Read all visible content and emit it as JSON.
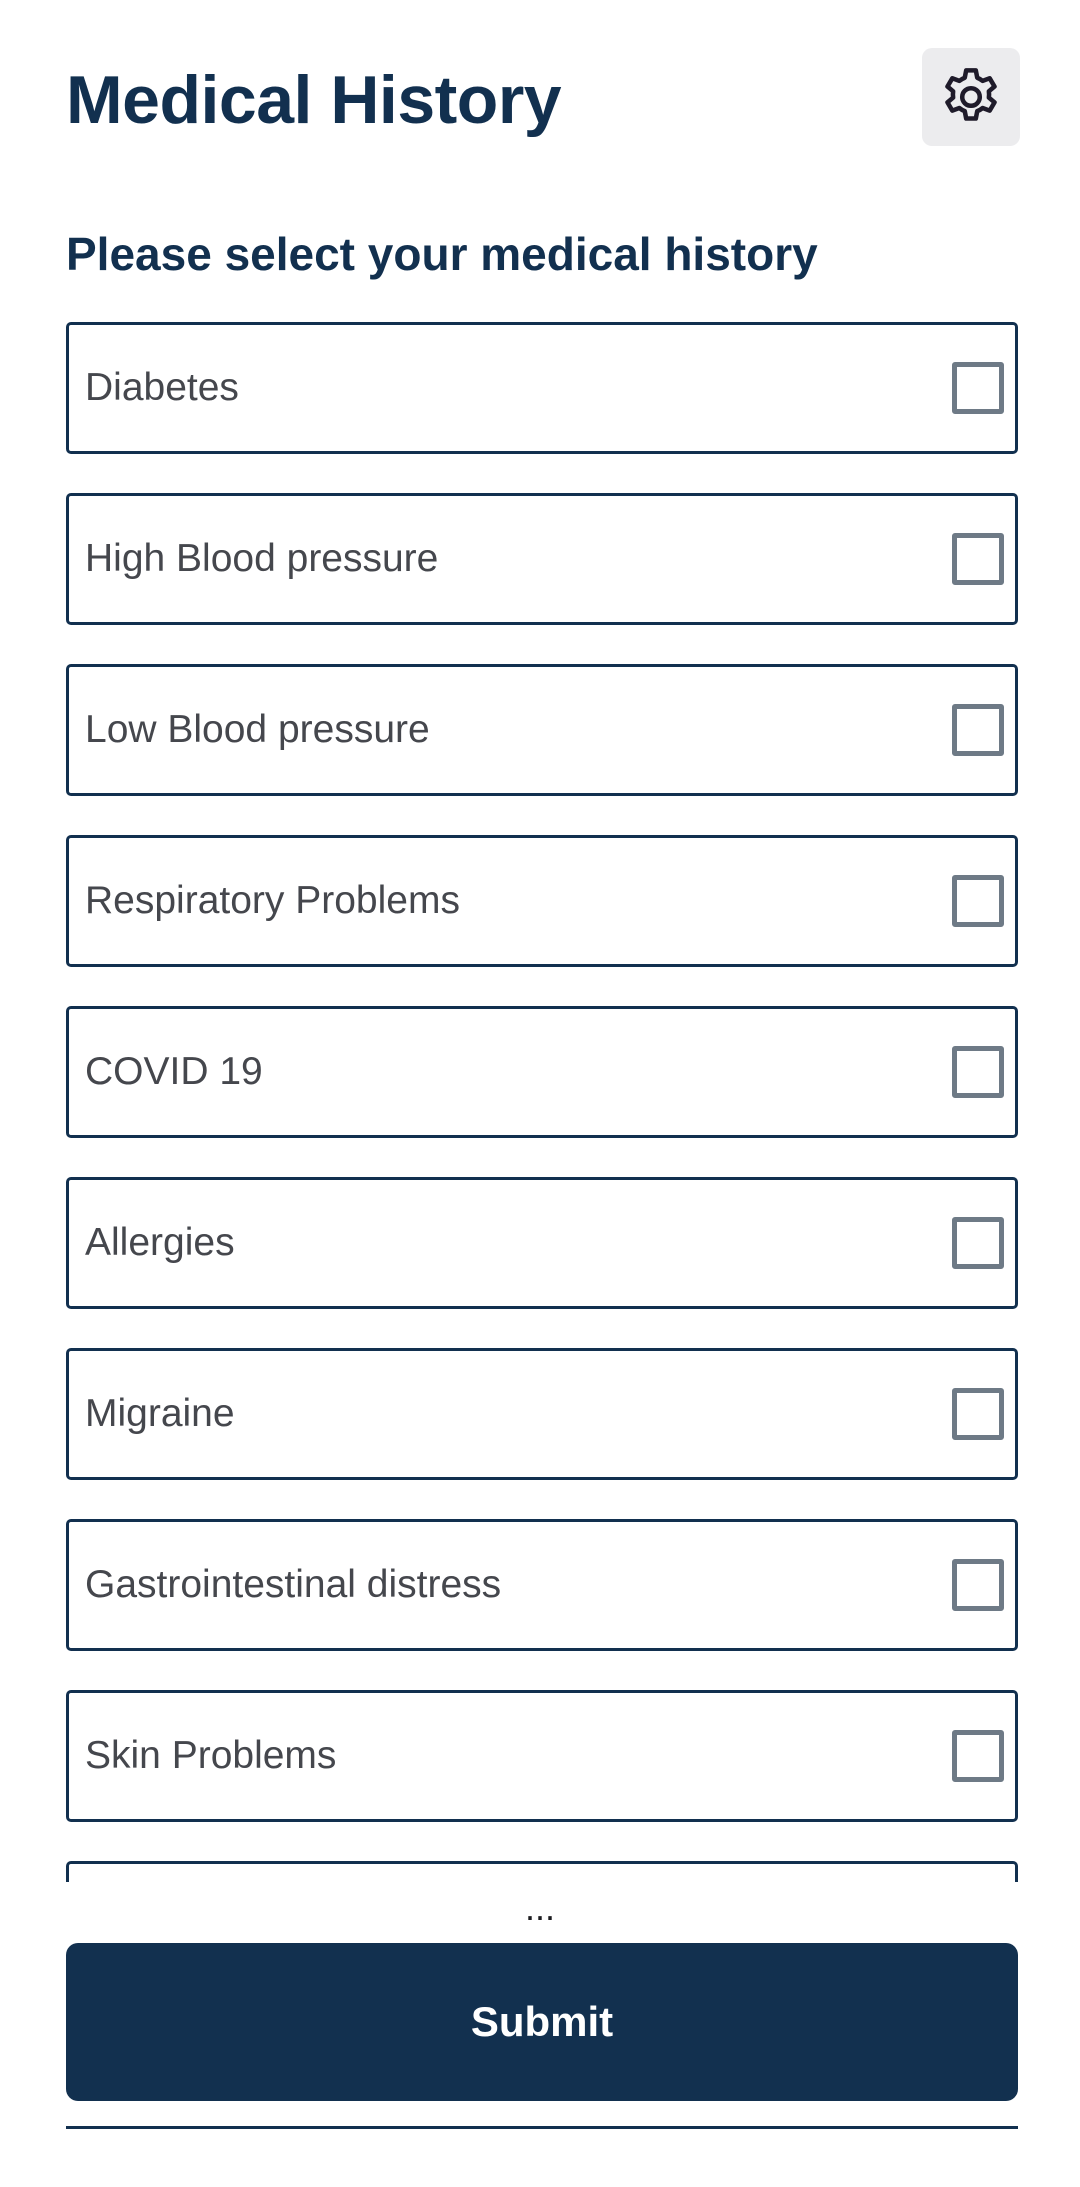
{
  "header": {
    "title": "Medical History",
    "settings_icon": "gear-icon"
  },
  "form": {
    "prompt": "Please select your medical history",
    "options": [
      {
        "label": "Diabetes",
        "checked": false
      },
      {
        "label": "High Blood pressure",
        "checked": false
      },
      {
        "label": "Low Blood pressure",
        "checked": false
      },
      {
        "label": "Respiratory Problems",
        "checked": false
      },
      {
        "label": "COVID 19",
        "checked": false
      },
      {
        "label": "Allergies",
        "checked": false
      },
      {
        "label": "Migraine",
        "checked": false
      },
      {
        "label": "Gastrointestinal distress",
        "checked": false
      },
      {
        "label": "Skin Problems",
        "checked": false
      },
      {
        "label": "",
        "checked": false
      }
    ],
    "more_indicator": "...",
    "submit_label": "Submit"
  },
  "colors": {
    "primary": "#12304f",
    "text": "#45474d",
    "checkbox_border": "#6e7a86",
    "settings_bg": "#ececee",
    "background": "#ffffff"
  }
}
